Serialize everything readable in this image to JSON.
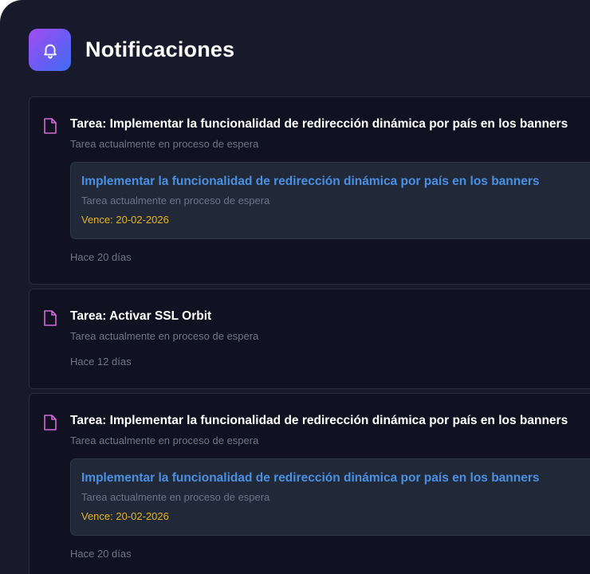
{
  "header": {
    "icon": "bell-icon",
    "title": "Notificaciones"
  },
  "notifications": [
    {
      "icon": "document-icon",
      "title": "Tarea: Implementar la funcionalidad de redirección dinámica por país en los banners",
      "subtitle": "Tarea actualmente en proceso de espera",
      "task": {
        "name": "Implementar la funcionalidad de redirección dinámica por país en los banners",
        "status": "Tarea actualmente en proceso de espera",
        "due": "Vence: 20-02-2026"
      },
      "time": "Hace 20 días"
    },
    {
      "icon": "document-icon",
      "title": "Tarea: Activar SSL Orbit",
      "subtitle": "Tarea actualmente en proceso de espera",
      "time": "Hace 12 días"
    },
    {
      "icon": "document-icon",
      "title": "Tarea: Implementar la funcionalidad de redirección dinámica por país en los banners",
      "subtitle": "Tarea actualmente en proceso de espera",
      "task": {
        "name": "Implementar la funcionalidad de redirección dinámica por país en los banners",
        "status": "Tarea actualmente en proceso de espera",
        "due": "Vence: 20-02-2026"
      },
      "time": "Hace 20 días"
    }
  ],
  "colors": {
    "panel_bg": "#181a2b",
    "card_bg": "#101221",
    "task_link": "#4a90e2",
    "due_date": "#e6b422",
    "doc_icon": "#d36ad6"
  }
}
